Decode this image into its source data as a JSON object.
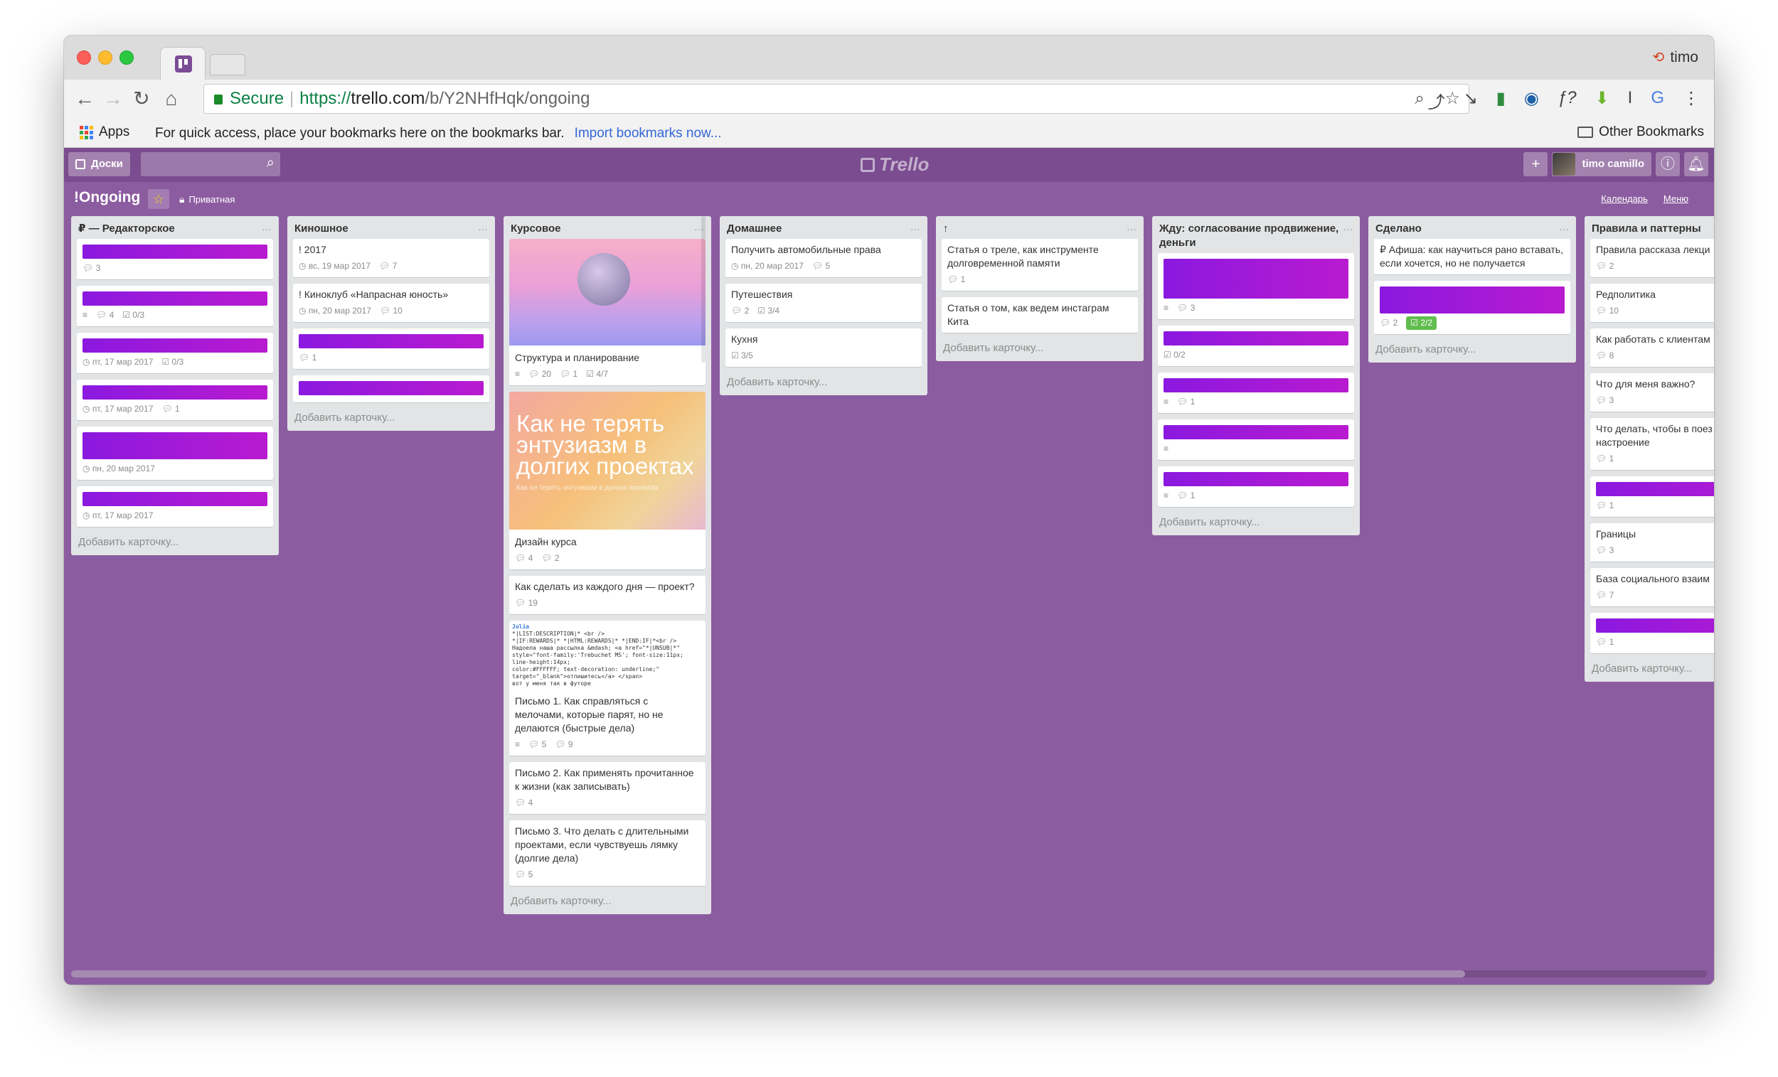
{
  "browser": {
    "user": "timo",
    "url": {
      "secure_label": "Secure",
      "scheme": "https://",
      "host": "trello.com",
      "path": "/b/Y2NHfHqk/ongoing"
    },
    "bookmarks": {
      "apps_label": "Apps",
      "hint": "For quick access, place your bookmarks here on the bookmarks bar.",
      "import_link": "Import bookmarks now...",
      "other_label": "Other Bookmarks"
    }
  },
  "header": {
    "boards_label": "Доски",
    "logo_text": "Trello",
    "member_name": "timo camillo"
  },
  "board": {
    "name": "!Ongoing",
    "visibility": "Приватная",
    "calendar_label": "Календарь",
    "menu_label": "Меню"
  },
  "add_card_label": "Добавить карточку...",
  "lists": [
    {
      "title": "₽ — Редакторское",
      "cards": [
        {
          "bar": true,
          "badges": [
            "3"
          ]
        },
        {
          "bar": true,
          "badges": [
            "≡",
            "4",
            "0/3"
          ]
        },
        {
          "bar": true,
          "badges": [
            "пт, 17 мар 2017",
            "0/3"
          ]
        },
        {
          "bar": true,
          "badges": [
            "пт, 17 мар 2017",
            "1"
          ]
        },
        {
          "bar": "tall",
          "badges": [
            "пн, 20 мар 2017"
          ]
        },
        {
          "bar": true,
          "badges": [
            "пт, 17 мар 2017"
          ]
        }
      ]
    },
    {
      "title": "Киношное",
      "cards": [
        {
          "title": "! 2017",
          "badges": [
            "вс, 19 мар 2017",
            "7"
          ]
        },
        {
          "title": "! Киноклуб «Напрасная юность»",
          "badges": [
            "пн, 20 мар 2017",
            "10"
          ]
        },
        {
          "bar": true,
          "badges": [
            "1"
          ]
        },
        {
          "bar": true,
          "badges": []
        }
      ]
    },
    {
      "title": "Курсовое",
      "cards": [
        {
          "cover": "moon",
          "title": "Структура и планирование",
          "badges": [
            "≡",
            "20",
            "1",
            "4/7"
          ]
        },
        {
          "cover": "enthusiasm",
          "cover_text": "Как не терять энтузиазм в долгих проектах",
          "cover_small": "Как не терять энтузиазм в долгих проектах",
          "title": "Дизайн курса",
          "badges": [
            "4",
            "2"
          ]
        },
        {
          "title": "Как сделать из каждого дня — проект?",
          "badges": [
            "19"
          ]
        },
        {
          "code": [
            "Julia",
            "*|LIST:DESCRIPTION|* <br />",
            "*|IF:REWARDS|* *|HTML:REWARDS|* *|END:IF|*<br />",
            "Надоела наша рассылка &mdash; <a href=\"*|UNSUB|*\"",
            "style=\"font-family:'Trebuchet MS'; font-size:11px; line-height:14px;",
            "color:#FFFFFF; text-decoration: underline;\"",
            "target=\"_blank\">отпишитесь</a> </span>",
            "",
            "вот у меня так в футоре"
          ],
          "title": "Письмо 1. Как справляться с мелочами, которые парят, но не делаются (быстрые дела)",
          "badges": [
            "≡",
            "5",
            "9"
          ]
        },
        {
          "title": "Письмо 2. Как применять прочитанное к жизни (как записывать)",
          "badges": [
            "4"
          ]
        },
        {
          "title": "Письмо 3. Что делать с длительными проектами, если чувствуешь лямку (долгие дела)",
          "badges": [
            "5"
          ]
        }
      ]
    },
    {
      "title": "Домашнее",
      "cards": [
        {
          "title": "Получить автомобильные права",
          "badges": [
            "пн, 20 мар 2017",
            "5"
          ]
        },
        {
          "title": "Путешествия",
          "badges": [
            "2",
            "3/4"
          ]
        },
        {
          "title": "Кухня",
          "badges": [
            "3/5"
          ]
        }
      ]
    },
    {
      "title": "↑",
      "cards": [
        {
          "title": "Статья о треле, как инструменте долговременной памяти",
          "badges": [
            "1"
          ]
        },
        {
          "title": "Статья о том, как ведем инстаграм Кита",
          "badges": []
        }
      ]
    },
    {
      "title": "Жду: согласование продвижение, деньги",
      "cards": [
        {
          "bar": "xtall",
          "badges": [
            "≡",
            "3"
          ]
        },
        {
          "bar": true,
          "badges": [
            "0/2"
          ]
        },
        {
          "bar": true,
          "badges": [
            "≡",
            "1"
          ]
        },
        {
          "bar": true,
          "badges": [
            "≡"
          ]
        },
        {
          "bar": true,
          "badges": [
            "≡",
            "1"
          ]
        }
      ]
    },
    {
      "title": "Сделано",
      "cards": [
        {
          "title": "₽ Афиша: как научиться рано вставать, если хочется, но не получается",
          "badges": []
        },
        {
          "bar": "tall",
          "badges": [
            "2"
          ],
          "green_badge": "2/2"
        }
      ]
    },
    {
      "title": "Правила и паттерны",
      "cards": [
        {
          "title": "Правила рассказа лекци",
          "badges": [
            "2"
          ]
        },
        {
          "title": "Редполитика",
          "badges": [
            "10"
          ]
        },
        {
          "title": "Как работать с клиентам",
          "badges": [
            "8"
          ]
        },
        {
          "title": "Что для меня важно?",
          "badges": [
            "3"
          ]
        },
        {
          "title": "Что делать, чтобы в поез портилось настроение",
          "badges": [
            "1"
          ]
        },
        {
          "bar": true,
          "badges": [
            "1"
          ]
        },
        {
          "title": "Границы",
          "badges": [
            "3"
          ]
        },
        {
          "title": "База социального взаим",
          "badges": [
            "7"
          ]
        },
        {
          "bar": true,
          "badges": [
            "1"
          ]
        }
      ]
    }
  ]
}
